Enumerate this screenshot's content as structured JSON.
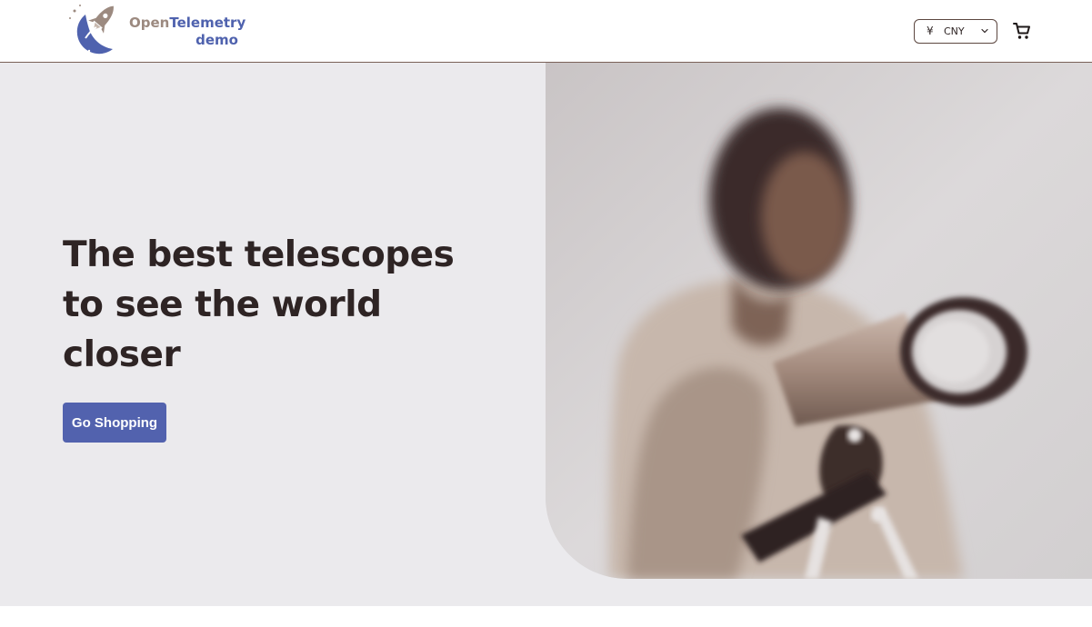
{
  "header": {
    "logo": {
      "word_open": "Open",
      "word_telemetry": "Telemetry",
      "word_demo": "demo",
      "icon": "rocket-globe-icon"
    },
    "currency": {
      "symbol": "¥",
      "selected": "CNY",
      "icon": "chevron-down-icon"
    },
    "cart_icon": "shopping-cart-icon"
  },
  "hero": {
    "title_line1": "The best telescopes",
    "title_line2": "to see the world",
    "title_line3": "closer",
    "cta_label": "Go Shopping",
    "image": "person-with-telescope-photo"
  },
  "colors": {
    "brand_blue": "#5262ae",
    "brand_taupe": "#9c8a80",
    "text_dark": "#2e2424",
    "hero_bg": "#ebeaed"
  }
}
